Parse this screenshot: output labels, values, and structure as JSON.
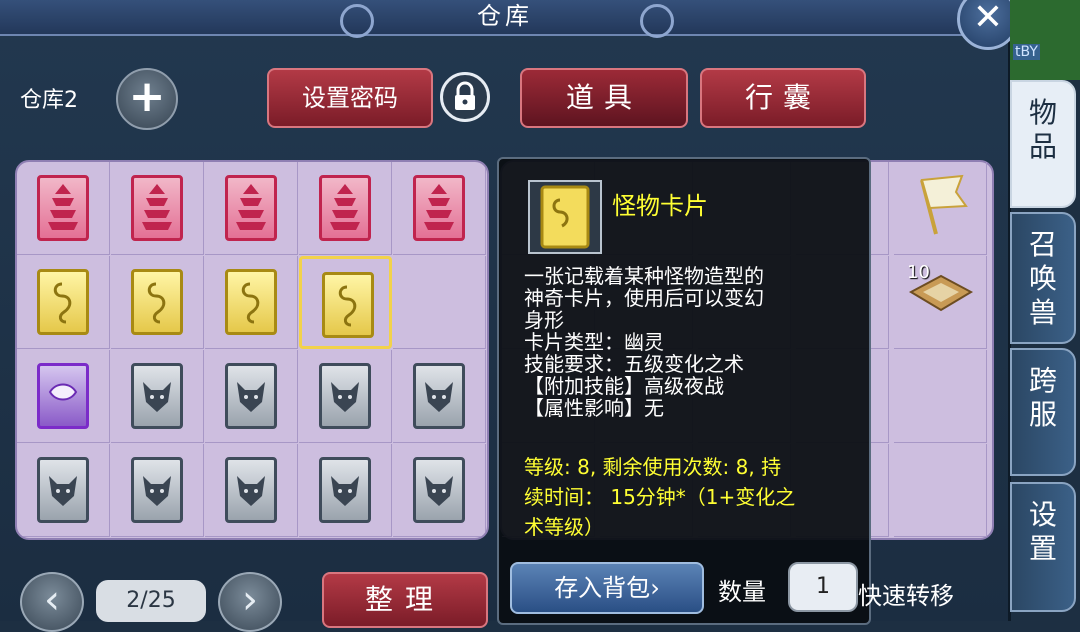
{
  "window": {
    "title": "仓库",
    "close_glyph": "✕"
  },
  "warehouse": {
    "label": "仓库2",
    "add_glyph": "+"
  },
  "buttons": {
    "set_password": "设置密码",
    "sort": "整理"
  },
  "tabs": {
    "items": "道具",
    "bag": "行囊"
  },
  "grid": {
    "rows": [
      [
        "pagoda-card",
        "pagoda-card",
        "pagoda-card",
        "pagoda-card",
        "pagoda-card"
      ],
      [
        "monster-card",
        "monster-card",
        "monster-card",
        "monster-card-selected",
        ""
      ],
      [
        "purple-card",
        "wolf-card",
        "wolf-card",
        "wolf-card",
        "wolf-card"
      ],
      [
        "wolf-card",
        "wolf-card",
        "wolf-card",
        "wolf-card",
        "wolf-card"
      ]
    ]
  },
  "right_grid": {
    "scroll_count": "10"
  },
  "tooltip": {
    "name": "怪物卡片",
    "description": [
      "一张记载着某种怪物造型的",
      "神奇卡片，使用后可以变幻",
      "身形",
      "卡片类型：幽灵",
      "技能要求：五级变化之术",
      "【附加技能】高级夜战",
      "【属性影响】无"
    ],
    "stats": [
      "等级: 8, 剩余使用次数: 8, 持",
      "续时间：  15分钟*（1+变化之",
      "术等级）"
    ],
    "store_button": "存入背包",
    "store_arrow": "›",
    "quantity_label": "数量",
    "quantity_value": "1",
    "quick_transfer": "快速转移"
  },
  "pagination": {
    "current": "2/25",
    "prev_glyph": "‹",
    "next_glyph": "›"
  },
  "side_tabs": [
    {
      "label": "物品",
      "active": true
    },
    {
      "label": "召唤兽",
      "active": false
    },
    {
      "label": "跨服",
      "active": false
    },
    {
      "label": "设置",
      "active": false
    }
  ],
  "background_strip": {
    "text": "tBY"
  },
  "colors": {
    "accent_red": "#9c2a37",
    "highlight_yellow": "#ffff33",
    "grid_bg": "#cdbedf"
  }
}
